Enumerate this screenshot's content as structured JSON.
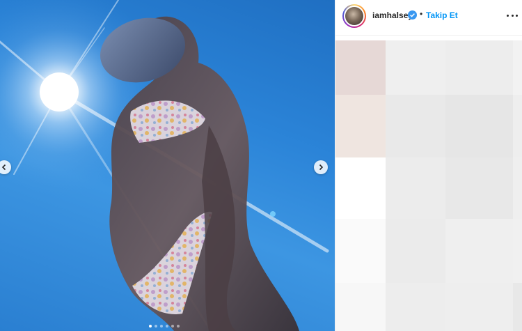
{
  "post": {
    "username": "iamhalsey",
    "verified": true,
    "separator": "•",
    "follow_label": "Takip Et"
  },
  "carousel": {
    "slide_count": 6,
    "active_slide": 1
  },
  "icons": {
    "prev": "chevron-left-icon",
    "next": "chevron-right-icon",
    "verified": "verified-badge-icon",
    "more": "more-options-icon"
  },
  "colors": {
    "follow": "#0095f6",
    "verified": "#3897f0",
    "sky": "#2b84d8"
  }
}
